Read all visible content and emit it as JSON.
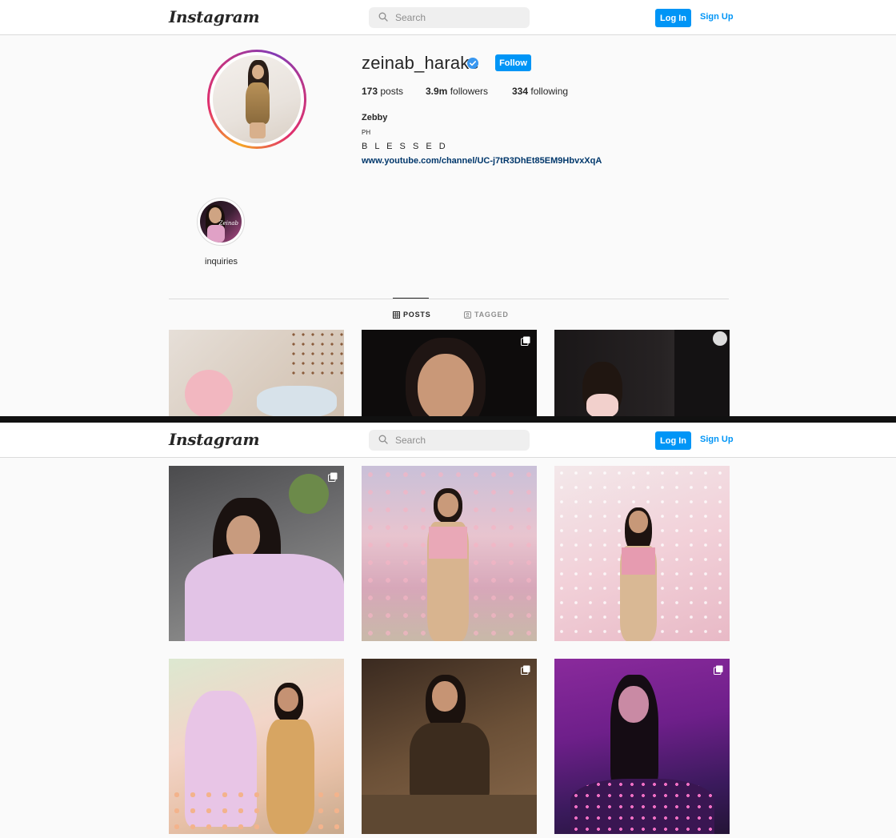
{
  "header": {
    "logo": "Instagram",
    "search_placeholder": "Search",
    "login_label": "Log In",
    "signup_label": "Sign Up"
  },
  "profile": {
    "username": "zeinab_harake",
    "verified": true,
    "follow_label": "Follow",
    "stats": {
      "posts_count": "173",
      "posts_label": "posts",
      "followers_count": "3.9m",
      "followers_label": "followers",
      "following_count": "334",
      "following_label": "following"
    },
    "bio": {
      "name": "Zebby",
      "line1": "PH",
      "line2": "B L E S S E D",
      "link": "www.youtube.com/channel/UC-j7tR3DhEt85EM9HbvxXqA"
    }
  },
  "highlights": [
    {
      "label": "inquiries",
      "overlay_text": "Zeinab"
    }
  ],
  "tabs": [
    {
      "label": "POSTS",
      "icon": "grid-icon",
      "active": true
    },
    {
      "label": "TAGGED",
      "icon": "tagged-icon",
      "active": false
    }
  ],
  "colors": {
    "accent": "#0095f6",
    "link": "#00376b",
    "verified": "#3897f0"
  }
}
